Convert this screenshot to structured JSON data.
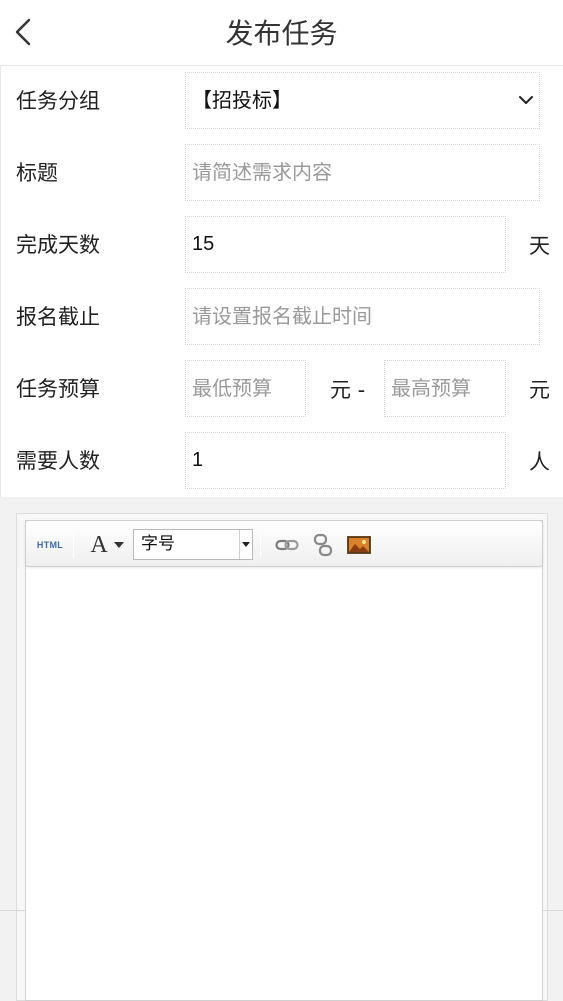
{
  "header": {
    "title": "发布任务"
  },
  "form": {
    "group": {
      "label": "任务分组",
      "value": "【招投标】"
    },
    "title": {
      "label": "标题",
      "placeholder": "请简述需求内容"
    },
    "days": {
      "label": "完成天数",
      "value": "15",
      "unit": "天"
    },
    "deadline": {
      "label": "报名截止",
      "placeholder": "请设置报名截止时间"
    },
    "budget": {
      "label": "任务预算",
      "min_placeholder": "最低预算",
      "min_unit": "元 -",
      "max_placeholder": "最高预算",
      "max_unit": "元"
    },
    "people": {
      "label": "需要人数",
      "value": "1",
      "unit": "人"
    }
  },
  "editor": {
    "toolbar": {
      "html_label": "HTML",
      "font_icon_label": "A",
      "font_size_label": "字号"
    },
    "icons": [
      "html-icon",
      "font-color-icon",
      "link-icon",
      "unlink-icon",
      "image-icon"
    ],
    "content": ""
  },
  "colors": {
    "border": "#d6d6d6",
    "placeholder": "#9a9a9a",
    "editor_bg": "#f2f2f2",
    "html_btn": "#3a6aa8"
  }
}
